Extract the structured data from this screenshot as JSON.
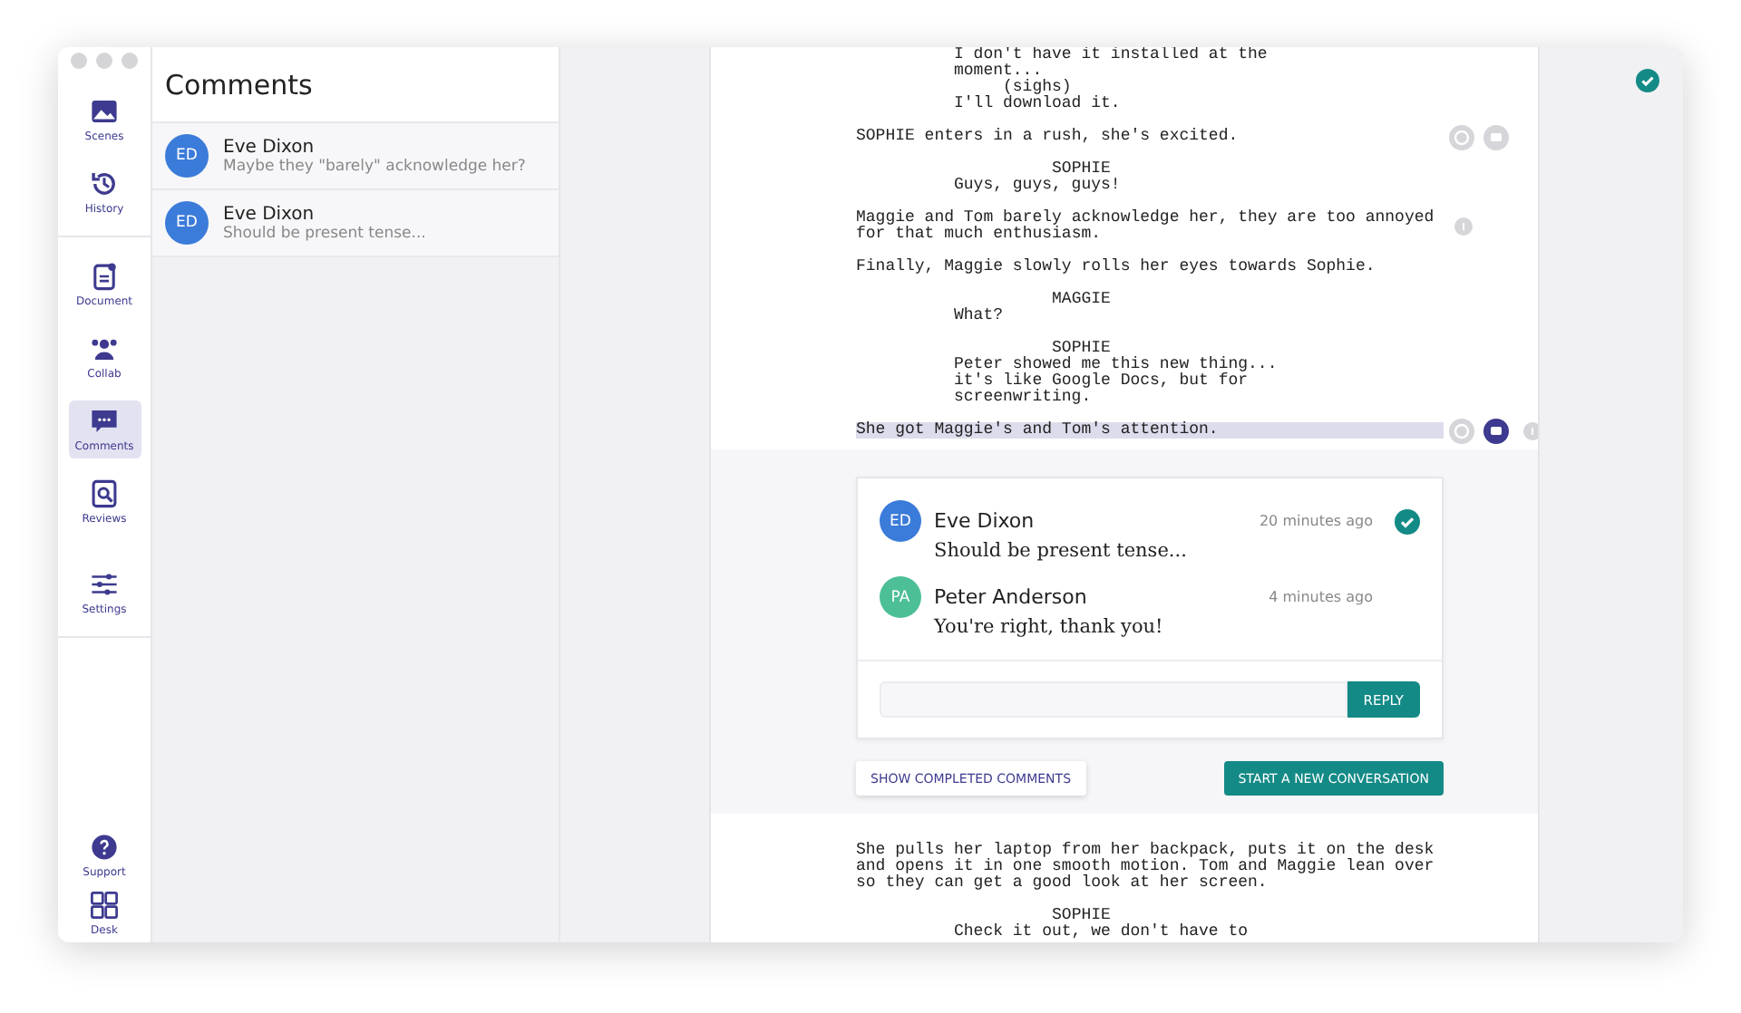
{
  "nav": {
    "groups": [
      [
        {
          "label": "Scenes",
          "selected": false
        },
        {
          "label": "History",
          "selected": false
        }
      ],
      [
        {
          "label": "Document",
          "selected": false
        },
        {
          "label": "Collab",
          "selected": false
        },
        {
          "label": "Comments",
          "selected": true
        },
        {
          "label": "Reviews",
          "selected": false
        }
      ],
      [
        {
          "label": "Settings",
          "selected": false
        }
      ]
    ],
    "bottom": [
      {
        "label": "Support",
        "selected": false
      },
      {
        "label": "Desk",
        "selected": false
      }
    ]
  },
  "comments_panel": {
    "title": "Comments",
    "items": [
      {
        "initials": "ED",
        "name": "Eve Dixon",
        "text": "Maybe they \"barely\" acknowledge her?",
        "color": "#3b7bd9"
      },
      {
        "initials": "ED",
        "name": "Eve Dixon",
        "text": "Should be present tense...",
        "color": "#3b7bd9"
      }
    ]
  },
  "script_top": [
    {
      "kind": "dialogue",
      "text": "I don't have it installed at the moment...",
      "highlighted": false,
      "comment_buttons": false,
      "note_dot": false
    },
    {
      "kind": "parenthetical",
      "text": "(sighs)",
      "highlighted": false,
      "comment_buttons": false,
      "note_dot": false
    },
    {
      "kind": "dialogue",
      "text": "I'll download it.",
      "highlighted": false,
      "comment_buttons": false,
      "note_dot": false
    },
    {
      "kind": "action",
      "text": "SOPHIE enters in a rush, she's excited.",
      "highlighted": false,
      "comment_buttons": true,
      "note_dot": false
    },
    {
      "kind": "character",
      "text": "SOPHIE",
      "highlighted": false,
      "comment_buttons": false,
      "note_dot": false
    },
    {
      "kind": "dialogue",
      "text": "Guys, guys, guys!",
      "highlighted": false,
      "comment_buttons": false,
      "note_dot": false
    },
    {
      "kind": "action",
      "text": "Maggie and Tom barely acknowledge her, they are too annoyed for that much enthusiasm.",
      "highlighted": false,
      "comment_buttons": false,
      "note_dot": true
    },
    {
      "kind": "action",
      "text": "Finally, Maggie slowly rolls her eyes towards Sophie.",
      "highlighted": false,
      "comment_buttons": false,
      "note_dot": false
    },
    {
      "kind": "character",
      "text": "MAGGIE",
      "highlighted": false,
      "comment_buttons": false,
      "note_dot": false
    },
    {
      "kind": "dialogue",
      "text": "What?",
      "highlighted": false,
      "comment_buttons": false,
      "note_dot": false
    },
    {
      "kind": "character",
      "text": "SOPHIE",
      "highlighted": false,
      "comment_buttons": false,
      "note_dot": false
    },
    {
      "kind": "dialogue",
      "text": "Peter showed me this new thing... it's like Google Docs, but for screenwriting.",
      "highlighted": false,
      "comment_buttons": false,
      "note_dot": false
    },
    {
      "kind": "action",
      "text": "She got Maggie's and Tom's attention.",
      "highlighted": true,
      "comment_buttons": true,
      "note_dot": true
    }
  ],
  "thread": {
    "comments": [
      {
        "initials": "ED",
        "name": "Eve Dixon",
        "time": "20 minutes ago",
        "text": "Should be present tense...",
        "color": "#3b7bd9",
        "resolved": true
      },
      {
        "initials": "PA",
        "name": "Peter Anderson",
        "time": "4 minutes ago",
        "text": "You're right, thank you!",
        "color": "#4cbf97",
        "resolved": false
      }
    ],
    "reply_button": "REPLY",
    "show_completed_button": "SHOW COMPLETED COMMENTS",
    "new_conversation_button": "START A NEW CONVERSATION"
  },
  "script_bottom": [
    {
      "kind": "action",
      "text": "She pulls her laptop from her backpack, puts it on the desk and opens it in one smooth motion. Tom and Maggie lean over so they can get a good look at her screen."
    },
    {
      "kind": "character",
      "text": "SOPHIE"
    },
    {
      "kind": "dialogue",
      "text": "Check it out, we don't have to"
    }
  ]
}
